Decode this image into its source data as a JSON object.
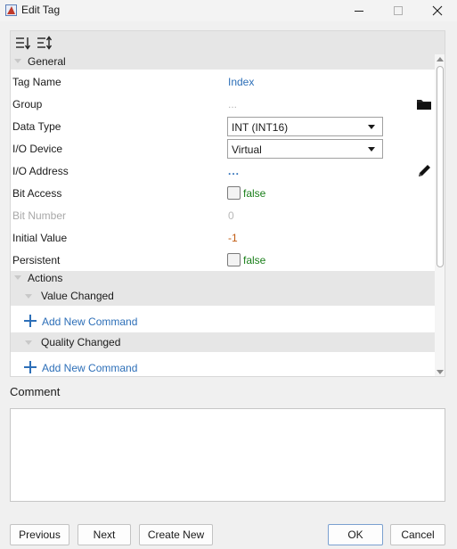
{
  "window": {
    "title": "Edit Tag",
    "app_icon": "app-logo-icon",
    "controls": [
      "minimize-icon",
      "maximize-icon",
      "close-icon"
    ]
  },
  "toolbar": {
    "buttons": [
      "sort-categorized-icon",
      "sort-alphabetical-icon"
    ]
  },
  "categories": {
    "general": "General",
    "actions": "Actions",
    "value_changed": "Value Changed",
    "quality_changed": "Quality Changed"
  },
  "properties": {
    "tag_name": {
      "label": "Tag Name",
      "value": "Index"
    },
    "group": {
      "label": "Group",
      "value": "...",
      "icon": "folder-icon"
    },
    "data_type": {
      "label": "Data Type",
      "value": "INT (INT16)"
    },
    "io_device": {
      "label": "I/O Device",
      "value": "Virtual"
    },
    "io_address": {
      "label": "I/O Address",
      "value": "...",
      "icon": "pencil-icon"
    },
    "bit_access": {
      "label": "Bit Access",
      "value": "false",
      "checked": false
    },
    "bit_number": {
      "label": "Bit Number",
      "value": "0"
    },
    "initial_value": {
      "label": "Initial Value",
      "value": "-1"
    },
    "persistent": {
      "label": "Persistent",
      "value": "false",
      "checked": false
    }
  },
  "actions": {
    "add_command_label": "Add New Command",
    "add_icon": "plus-icon"
  },
  "comment": {
    "label": "Comment",
    "value": ""
  },
  "buttons": {
    "previous": "Previous",
    "next": "Next",
    "create_new": "Create New",
    "ok": "OK",
    "cancel": "Cancel"
  },
  "colors": {
    "link": "#2d6fb8",
    "false_value": "#1a7f1a",
    "initial_value": "#c25b12",
    "category_bg": "#e6e6e6"
  }
}
